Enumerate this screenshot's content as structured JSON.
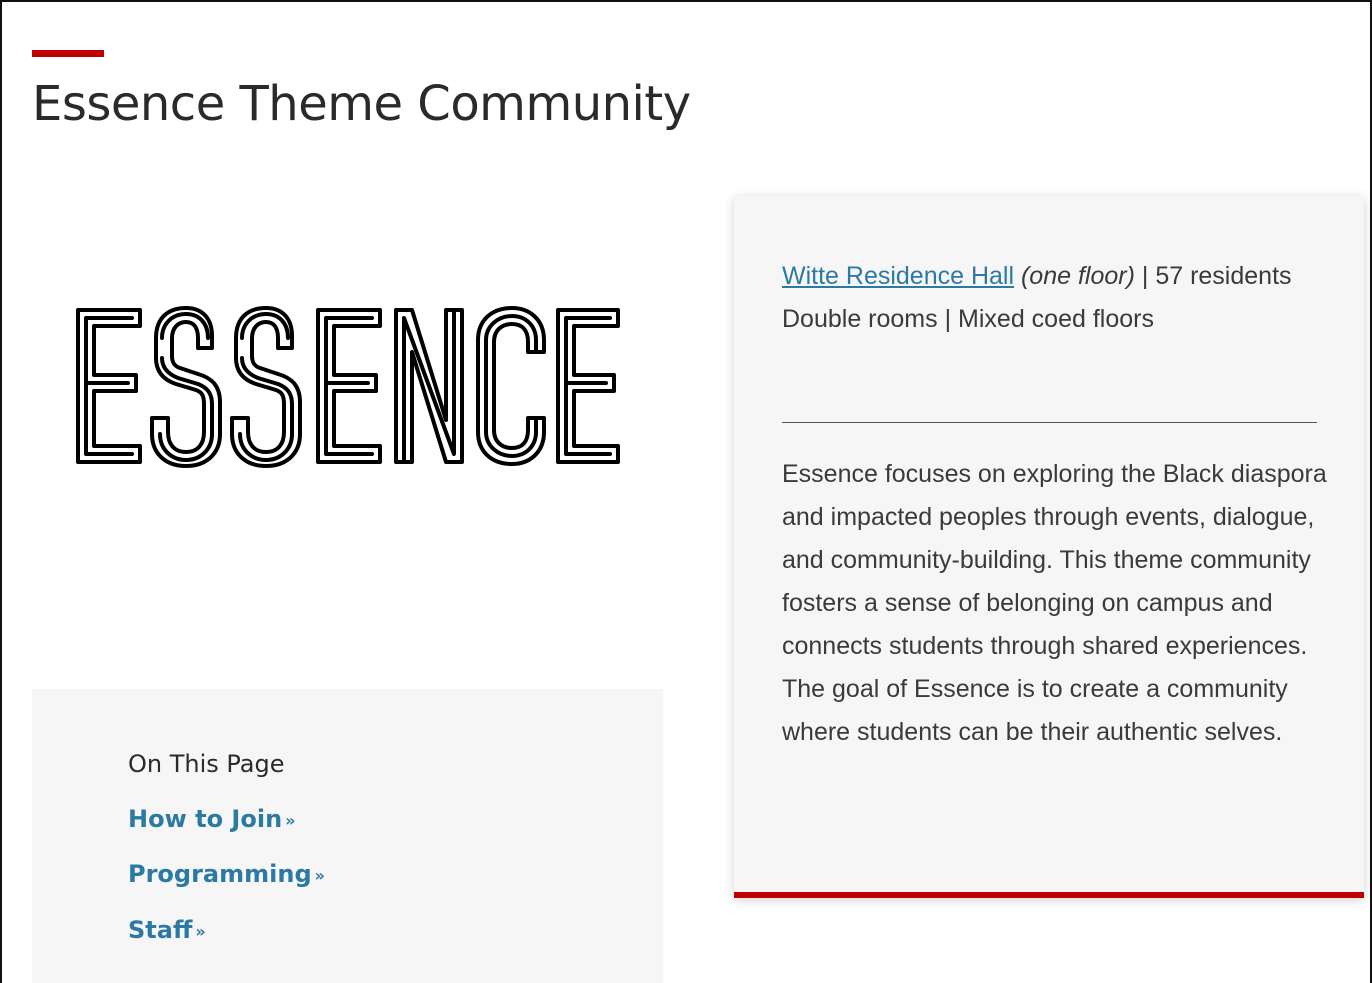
{
  "page": {
    "title": "Essence Theme Community"
  },
  "logo": {
    "text": "ESSENCE"
  },
  "on_this_page": {
    "heading": "On This Page",
    "chevron": "»",
    "links": [
      {
        "label": "How to Join"
      },
      {
        "label": "Programming"
      },
      {
        "label": "Staff"
      }
    ]
  },
  "info": {
    "hall_link": "Witte Residence Hall",
    "hall_note": "(one floor)",
    "separator": " | ",
    "residents": "57 residents",
    "room_type": "Double rooms",
    "floor_type": "Mixed coed floors",
    "description": "Essence focuses on exploring the Black diaspora and impacted peoples through events, dialogue, and community-building. This theme community fosters a sense of belonging on campus and connects students through shared experiences. The goal of Essence is to create a community where students can be their authentic selves."
  },
  "colors": {
    "accent": "#c00000",
    "link": "#2c7aa3",
    "panel_bg": "#f6f6f6",
    "text": "#2b2b2b"
  }
}
